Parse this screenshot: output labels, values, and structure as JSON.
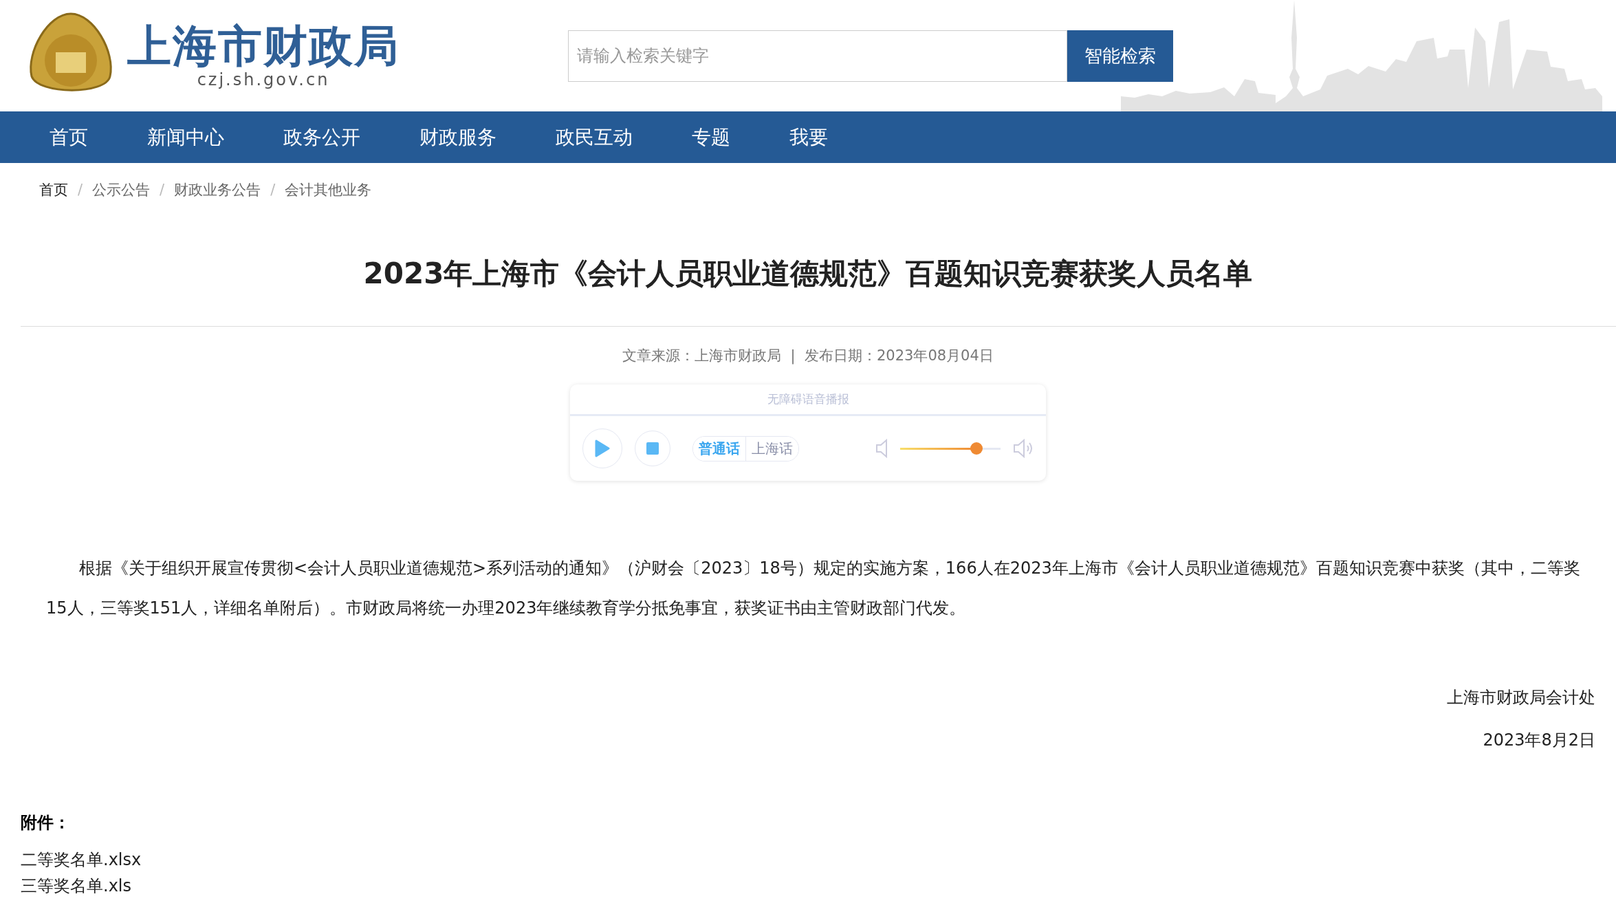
{
  "header": {
    "site_name": "上海市财政局",
    "domain": "czj.sh.gov.cn",
    "search": {
      "placeholder": "请输入检索关键字",
      "button": "智能检索"
    }
  },
  "nav": [
    {
      "label": "首页"
    },
    {
      "label": "新闻中心"
    },
    {
      "label": "政务公开"
    },
    {
      "label": "财政服务"
    },
    {
      "label": "政民互动"
    },
    {
      "label": "专题"
    },
    {
      "label": "我要"
    }
  ],
  "breadcrumb": [
    {
      "label": "首页",
      "dimmed": false
    },
    {
      "label": "公示公告",
      "dimmed": true
    },
    {
      "label": "财政业务公告",
      "dimmed": true
    },
    {
      "label": "会计其他业务",
      "dimmed": true
    }
  ],
  "breadcrumb_separator": "/",
  "article": {
    "title": "2023年上海市《会计人员职业道德规范》百题知识竞赛获奖人员名单",
    "meta": "文章来源：上海市财政局  |  发布日期：2023年08月04日",
    "player": {
      "title": "无障碍语音播报",
      "languages": [
        {
          "label": "普通话",
          "selected": true
        },
        {
          "label": "上海话",
          "selected": false
        }
      ],
      "volume": {
        "level": 0.76
      }
    },
    "body": "根据《关于组织开展宣传贯彻<会计人员职业道德规范>系列活动的通知》（沪财会〔2023〕18号）规定的实施方案，166人在2023年上海市《会计人员职业道德规范》百题知识竞赛中获奖（其中，二等奖15人，三等奖151人，详细名单附后）。市财政局将统一办理2023年继续教育学分抵免事宜，获奖证书由主管财政部门代发。",
    "signature": [
      "上海市财政局会计处",
      "2023年8月2日"
    ],
    "attachments_label": "附件：",
    "attachments": [
      "二等奖名单.xlsx",
      "三等奖名单.xls"
    ]
  }
}
